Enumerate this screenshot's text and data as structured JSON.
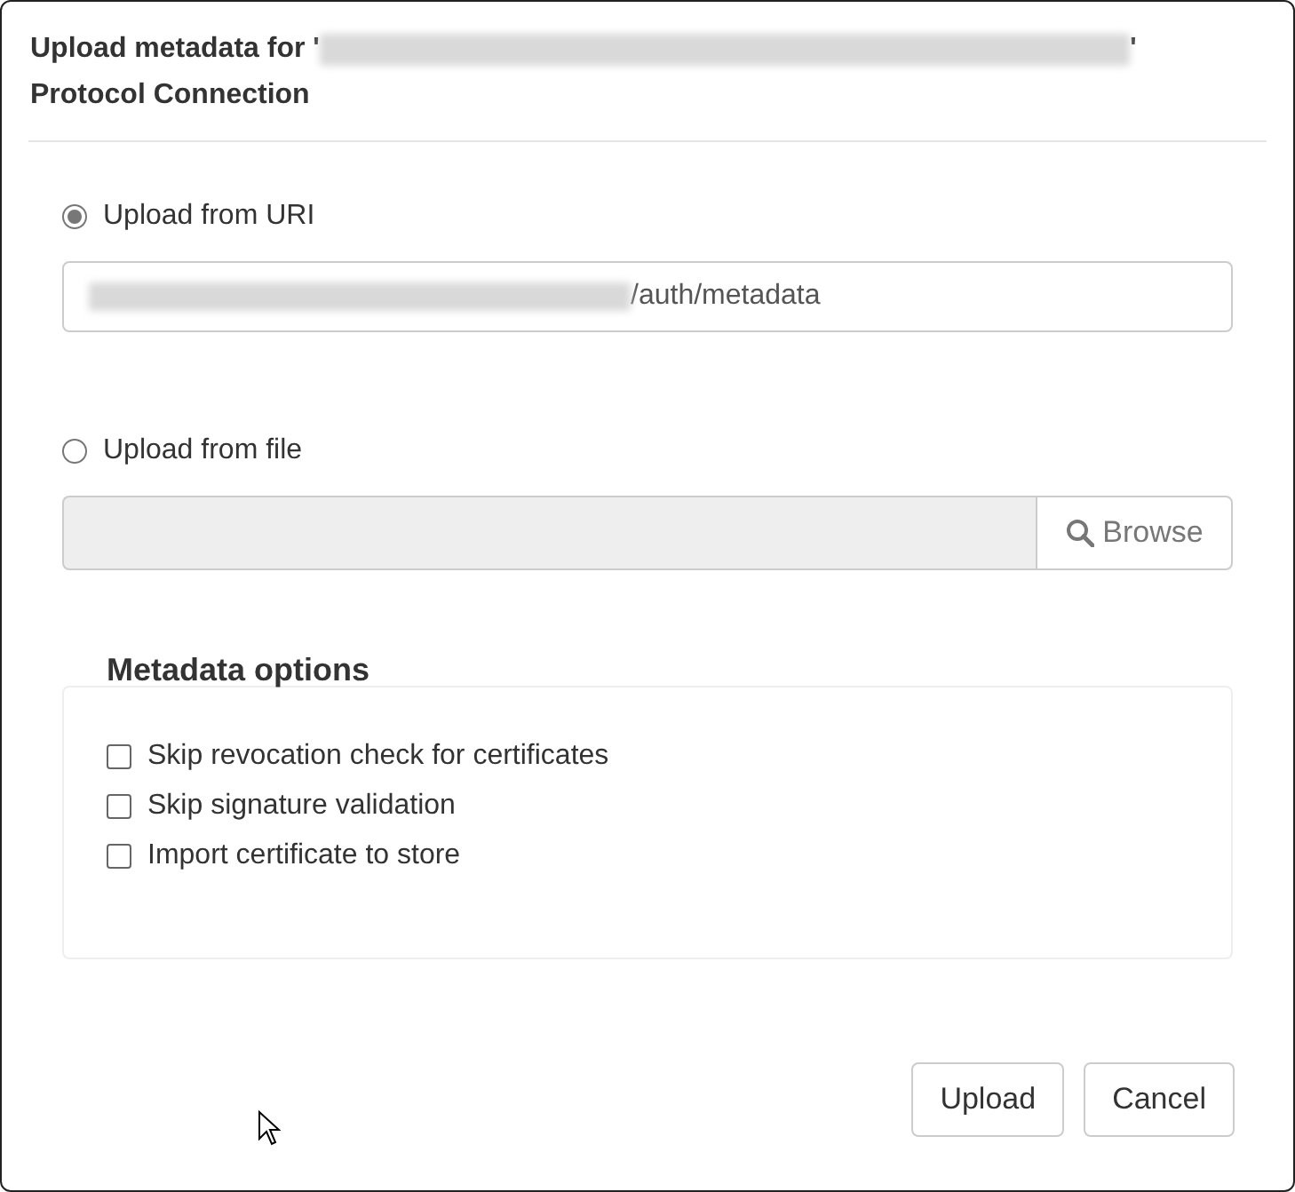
{
  "dialog": {
    "title_start": "Upload metadata for '",
    "title_end": "'",
    "title_line_2": "Protocol Connection"
  },
  "sources": [
    {
      "kind": "uri",
      "label": "Upload from URI",
      "selected": true,
      "value_end": "/auth/metadata"
    },
    {
      "kind": "file",
      "label": "Upload from file",
      "selected": false,
      "button": "Browse"
    }
  ],
  "metadata_options": {
    "legend": "Metadata options",
    "items": [
      {
        "label": "Skip revocation check for certificates",
        "checked": false
      },
      {
        "label": "Skip signature validation",
        "checked": false
      },
      {
        "label": "Import certificate to store",
        "checked": false
      }
    ]
  },
  "buttons": [
    "Upload",
    "Cancel"
  ]
}
